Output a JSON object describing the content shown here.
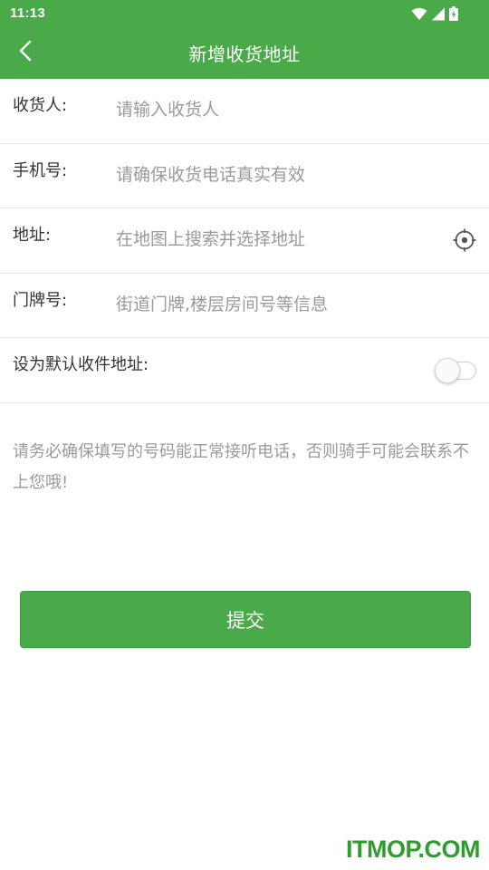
{
  "status_bar": {
    "time": "11:13",
    "icons": [
      "wifi-icon",
      "cell-signal-icon",
      "battery-charging-icon"
    ]
  },
  "app_bar": {
    "back_icon": "chevron-left-icon",
    "title": "新增收货地址"
  },
  "form": {
    "recipient": {
      "label": "收货人:",
      "placeholder": "请输入收货人",
      "value": ""
    },
    "phone": {
      "label": "手机号:",
      "placeholder": "请确保收货电话真实有效",
      "value": ""
    },
    "address": {
      "label": "地址:",
      "placeholder": "在地图上搜索并选择地址",
      "value": "",
      "action_icon": "locate-target-icon"
    },
    "door_number": {
      "label": "门牌号:",
      "placeholder": "街道门牌,楼层房间号等信息",
      "value": ""
    },
    "default_address": {
      "label": "设为默认收件地址:",
      "enabled": false
    }
  },
  "notice": "请务必确保填写的号码能正常接听电话，否则骑手可能会联系不上您哦!",
  "submit_label": "提交",
  "watermark": "ITMOP.COM",
  "colors": {
    "primary_green": "#4aaa4a",
    "placeholder_gray": "#9a9a9a",
    "label_text": "#333333",
    "divider": "#e8e8e8",
    "watermark_green": "#2e9c2e"
  }
}
